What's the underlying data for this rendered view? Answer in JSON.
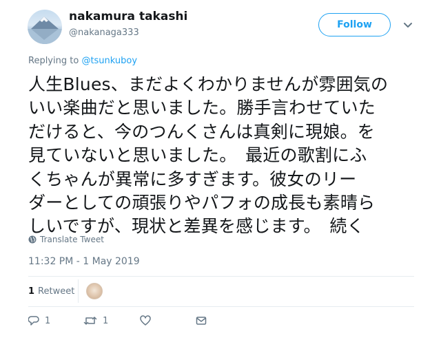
{
  "user": {
    "name": "nakamura takashi",
    "handle": "@nakanaga333"
  },
  "follow_label": "Follow",
  "reply_context": {
    "prefix": "Replying to",
    "mention": "@tsunkuboy"
  },
  "tweet": {
    "lines": [
      "人生Blues、まだよくわかりませんが雰囲気の",
      "いい楽曲だと思いました。勝手言わせていた",
      "だけると、今のつんくさんは真剣に現娘。を",
      "見ていないと思いました。　最近の歌割にふ",
      "くちゃんが異常に多すぎます。彼女のリー",
      "ダーとしての頑張りやパフォの成長も素晴ら",
      "しいですが、現状と差異を感じます。　続く"
    ]
  },
  "translate_label": "Translate Tweet",
  "timestamp": "11:32 PM - 1 May 2019",
  "stats": {
    "retweet_count": "1",
    "retweet_label": "Retweet"
  },
  "actions": {
    "reply_count": "1",
    "retweet_count": "1"
  },
  "colors": {
    "accent": "#1da1f2",
    "muted": "#657786",
    "divider": "#e6ecf0"
  },
  "icons": [
    "globe-icon",
    "chevron-down-icon",
    "reply-icon",
    "retweet-icon",
    "heart-icon",
    "message-icon"
  ]
}
